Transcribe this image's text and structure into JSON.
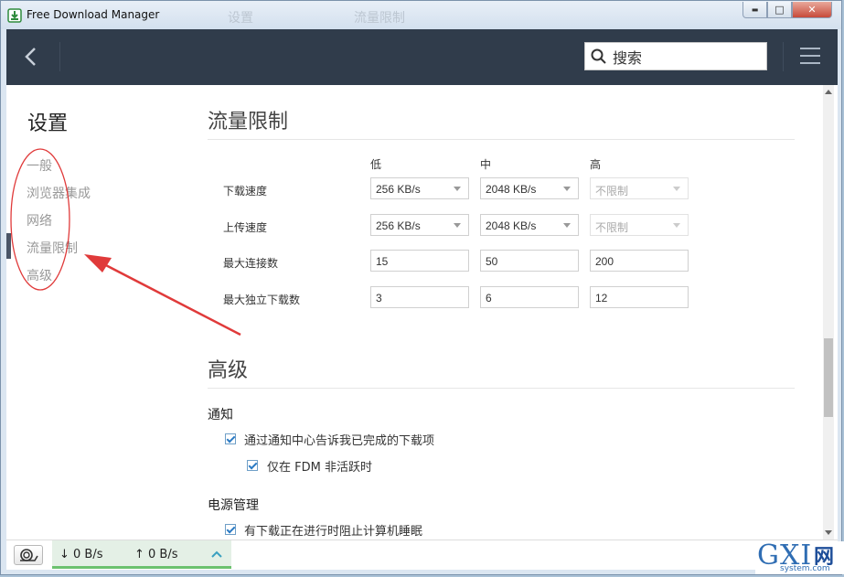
{
  "window": {
    "title": "Free Download Manager",
    "ghost_left": "设置",
    "ghost_right": "流量限制",
    "min": "▬",
    "max": "□",
    "close": "✕"
  },
  "header": {
    "search_placeholder": "搜索"
  },
  "sidebar": {
    "title": "设置",
    "items": [
      {
        "label": "一般"
      },
      {
        "label": "浏览器集成"
      },
      {
        "label": "网络"
      },
      {
        "label": "流量限制"
      },
      {
        "label": "高级"
      }
    ]
  },
  "traffic": {
    "heading": "流量限制",
    "columns": [
      "低",
      "中",
      "高"
    ],
    "rows": [
      {
        "label": "下载速度",
        "values": [
          "256 KB/s",
          "2048 KB/s",
          "不限制"
        ]
      },
      {
        "label": "上传速度",
        "values": [
          "256 KB/s",
          "2048 KB/s",
          "不限制"
        ]
      },
      {
        "label": "最大连接数",
        "values": [
          "15",
          "50",
          "200"
        ]
      },
      {
        "label": "最大独立下载数",
        "values": [
          "3",
          "6",
          "12"
        ]
      }
    ]
  },
  "advanced": {
    "heading": "高级",
    "notify_title": "通知",
    "notify_opt1": "通过通知中心告诉我已完成的下载项",
    "notify_opt2": "仅在 FDM 非活跃时",
    "power_title": "电源管理",
    "power_opt1": "有下载正在进行时阻止计算机睡眠"
  },
  "status": {
    "down": "↓ 0 B/s",
    "up": "↑ 0 B/s"
  },
  "watermark": {
    "brand": "GXI",
    "cn": "网",
    "url": "system.com"
  },
  "colors": {
    "header_bg": "#303c4b",
    "accent_green": "#6cc26f",
    "annotation_red": "#e03a3a"
  }
}
